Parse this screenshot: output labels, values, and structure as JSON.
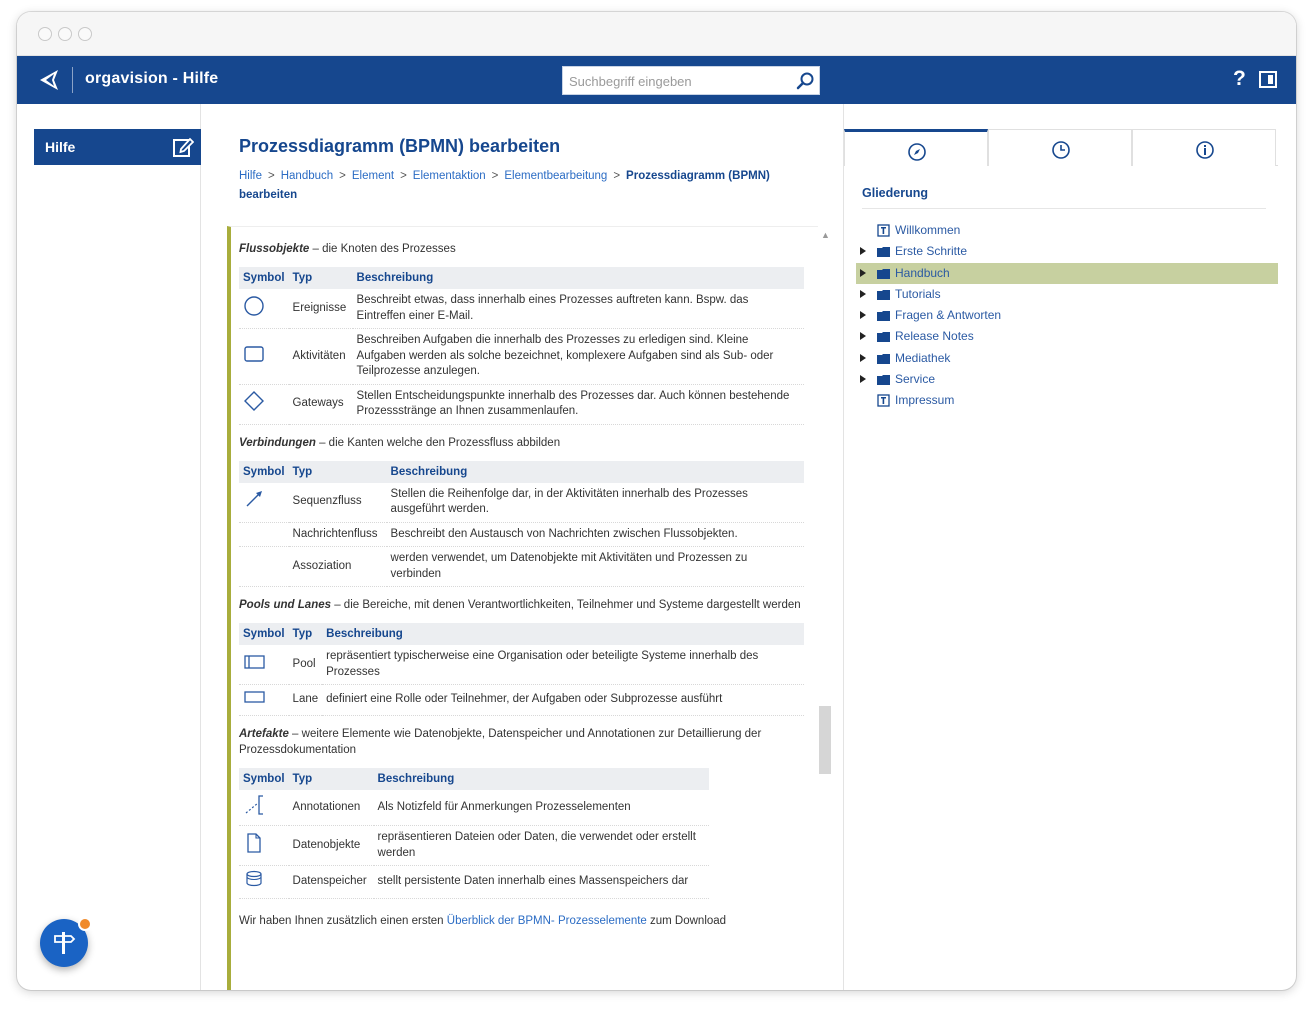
{
  "app": {
    "title": "orgavision - Hilfe"
  },
  "search": {
    "placeholder": "Suchbegriff eingeben"
  },
  "header": {
    "help_label": "?"
  },
  "sidebar": {
    "tab_label": "Hilfe"
  },
  "page": {
    "title": "Prozessdiagramm (BPMN) bearbeiten",
    "breadcrumb": [
      "Hilfe",
      "Handbuch",
      "Element",
      "Elementaktion",
      "Elementbearbeitung"
    ],
    "breadcrumb_current": "Prozessdiagramm (BPMN) bearbeiten",
    "breadcrumb_separator": ">"
  },
  "content": {
    "flow": {
      "title": "Flussobjekte",
      "desc": " – die Knoten des Prozesses",
      "headers": [
        "Symbol",
        "Typ",
        "Beschreibung"
      ],
      "rows": [
        {
          "type": "Ereignisse",
          "desc": "Beschreibt etwas, dass innerhalb eines Prozesses auftreten kann. Bspw. das Eintreffen einer E-Mail.",
          "icon": "circle-event-icon"
        },
        {
          "type": "Aktivitäten",
          "desc": "Beschreiben Aufgaben die innerhalb des Prozesses zu erledigen sind. Kleine Aufgaben werden als solche bezeichnet, komplexere Aufgaben sind als Sub- oder Teilprozesse anzulegen.",
          "icon": "rounded-rect-activity-icon"
        },
        {
          "type": "Gateways",
          "desc": "Stellen Entscheidungspunkte innerhalb des Prozesses dar. Auch können bestehende Prozessstränge an Ihnen zusammenlaufen.",
          "icon": "diamond-gateway-icon"
        }
      ]
    },
    "connections": {
      "title": "Verbindungen",
      "desc": " – die Kanten welche den Prozessfluss abbilden",
      "headers": [
        "Symbol",
        "Typ",
        "Beschreibung"
      ],
      "rows": [
        {
          "type": "Sequenzfluss",
          "desc": "Stellen die Reihenfolge dar, in der Aktivitäten innerhalb des Prozesses ausgeführt werden.",
          "icon": "arrow-sequence-icon"
        },
        {
          "type": "Nachrichtenfluss",
          "desc": "Beschreibt den Austausch von Nachrichten zwischen Flussobjekten.",
          "icon": ""
        },
        {
          "type": "Assoziation",
          "desc": "werden verwendet, um Datenobjekte mit Aktivitäten und Prozessen zu verbinden",
          "icon": ""
        }
      ]
    },
    "pools": {
      "title": "Pools und Lanes",
      "desc": " – die Bereiche, mit denen Verantwortlichkeiten, Teilnehmer und Systeme dargestellt werden",
      "headers": [
        "Symbol",
        "Typ",
        "Beschreibung"
      ],
      "rows": [
        {
          "type": "Pool",
          "desc": "repräsentiert typischerweise eine Organisation oder beteiligte Systeme innerhalb des Prozesses",
          "icon": "pool-icon"
        },
        {
          "type": "Lane",
          "desc": "definiert eine Rolle oder Teilnehmer, der Aufgaben oder Subprozesse ausführt",
          "icon": "lane-icon"
        }
      ]
    },
    "artifacts": {
      "title": "Artefakte",
      "desc": " – weitere Elemente wie Datenobjekte, Datenspeicher und Annotationen zur Detaillierung der Prozessdokumentation",
      "headers": [
        "Symbol",
        "Typ",
        "Beschreibung"
      ],
      "rows": [
        {
          "type": "Annotationen",
          "desc": "Als Notizfeld für Anmerkungen Prozesselementen",
          "icon": "annotation-icon"
        },
        {
          "type": "Datenobjekte",
          "desc": "repräsentieren Dateien oder Daten, die verwendet oder erstellt werden",
          "icon": "data-object-icon"
        },
        {
          "type": "Datenspeicher",
          "desc": "stellt persistente Daten innerhalb eines Massenspeichers dar",
          "icon": "data-store-icon"
        }
      ]
    },
    "footer_text_before": "Wir haben Ihnen zusätzlich einen ersten ",
    "footer_link": "Überblick der BPMN- Prozesselemente",
    "footer_text_after": " zum Download"
  },
  "outline": {
    "title": "Gliederung",
    "tabs": [
      "compass-icon",
      "clock-icon",
      "info-icon"
    ],
    "items": [
      {
        "label": "Willkommen",
        "type": "page",
        "expandable": false,
        "selected": false
      },
      {
        "label": "Erste Schritte",
        "type": "folder",
        "expandable": true,
        "selected": false
      },
      {
        "label": "Handbuch",
        "type": "folder",
        "expandable": true,
        "selected": true
      },
      {
        "label": "Tutorials",
        "type": "folder",
        "expandable": true,
        "selected": false
      },
      {
        "label": "Fragen & Antworten",
        "type": "folder",
        "expandable": true,
        "selected": false
      },
      {
        "label": "Release Notes",
        "type": "folder",
        "expandable": true,
        "selected": false
      },
      {
        "label": "Mediathek",
        "type": "folder",
        "expandable": true,
        "selected": false
      },
      {
        "label": "Service",
        "type": "folder",
        "expandable": true,
        "selected": false
      },
      {
        "label": "Impressum",
        "type": "page",
        "expandable": false,
        "selected": false
      }
    ]
  },
  "colors": {
    "brand": "#16478e",
    "accent_bar": "#a8ad3c",
    "selected_row": "#c7d0a0",
    "link": "#2b6cc4"
  }
}
